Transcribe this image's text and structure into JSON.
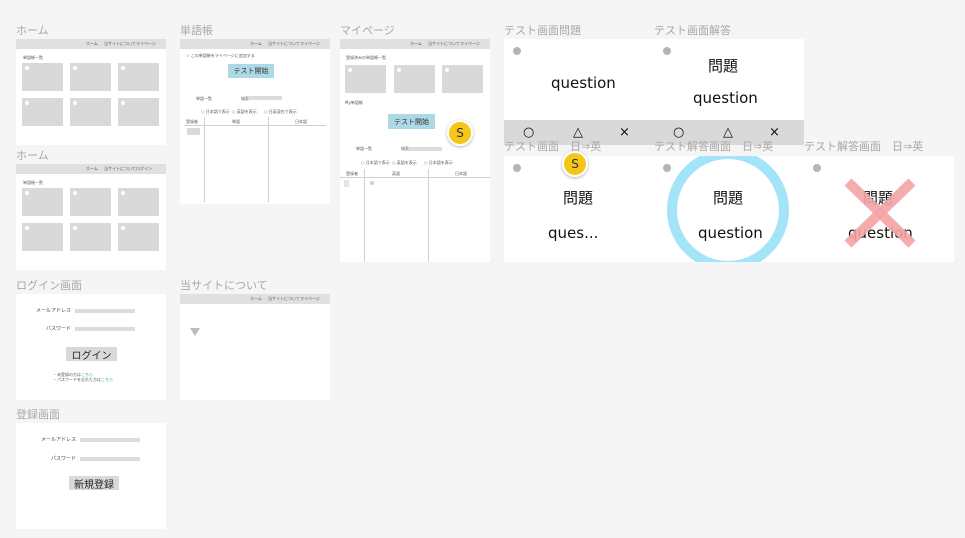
{
  "frames": {
    "home1": {
      "label": "ホーム",
      "nav": [
        "ホーム",
        "当サイトについて",
        "マイページ"
      ],
      "section": "単語帳一覧"
    },
    "home2": {
      "label": "ホーム",
      "nav": [
        "ホーム",
        "当サイトについて",
        "ログイン"
      ],
      "section": "単語帳一覧"
    },
    "login": {
      "label": "ログイン画面",
      "email_label": "メールアドレス",
      "password_label": "パスワード",
      "button": "ログイン",
      "signup_note": "・未登録の方は",
      "forgot_note": "・パスワードを忘れた方は",
      "link": "こちら"
    },
    "register": {
      "label": "登録画面",
      "email_label": "メールアドレス",
      "password_label": "パスワード",
      "button": "新規登録"
    },
    "wordbook": {
      "label": "単語帳",
      "nav": [
        "ホーム",
        "当サイトについて",
        "マイページ"
      ],
      "add_note": "☆ この単語帳をマイページに追加する",
      "test_button": "テスト開始",
      "list_title": "単語一覧",
      "search_label": "検索",
      "radios": [
        "○ 日本語で表示",
        "○ 英語を表示",
        "○ 日英混在で表示"
      ],
      "col_headers": [
        "登録者",
        "単語",
        "日本語"
      ]
    },
    "about": {
      "label": "当サイトについて",
      "nav": [
        "ホーム",
        "当サイトについて",
        "マイページ"
      ]
    },
    "mypage": {
      "label": "マイページ",
      "nav": [
        "ホーム",
        "当サイトについて",
        "マイページ"
      ],
      "section": "登録済みの単語帳一覧",
      "my_wordbook": "My単語帳",
      "test_button": "テスト開始",
      "list_title": "単語一覧",
      "search_label": "検索",
      "radios": [
        "○ 日本語で表示",
        "○ 英語を表示",
        "○ 日本語を表示"
      ],
      "col_headers": [
        "登録者",
        "英語",
        "日本語"
      ],
      "avatar": "S"
    },
    "test_q": {
      "label": "テスト画面問題",
      "question": "question",
      "symbols": [
        "○",
        "△",
        "×"
      ]
    },
    "test_a": {
      "label": "テスト画面解答",
      "problem": "問題",
      "question": "question",
      "symbols": [
        "○",
        "△",
        "×"
      ]
    },
    "test_je": {
      "label": "テスト画面　日⇒英",
      "problem": "問題",
      "question": "ques...",
      "avatar": "S"
    },
    "ans_je_correct": {
      "label": "テスト解答画面　日⇒英",
      "problem": "問題",
      "question": "question"
    },
    "ans_je_wrong": {
      "label": "テスト解答画面　日⇒英",
      "problem": "問題",
      "question": "question"
    }
  },
  "colors": {
    "accent_blue": "#add8e6",
    "correct_ring": "#a4e4f8",
    "wrong_cross": "#f4a3a3",
    "avatar": "#f5c518",
    "link": "#33aa88"
  }
}
